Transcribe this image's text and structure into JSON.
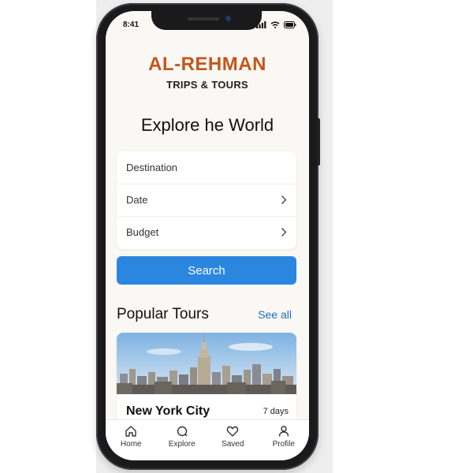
{
  "status_bar": {
    "time": "8:41",
    "signal_icon": "cellular-signal-icon",
    "wifi_icon": "wifi-icon",
    "battery_icon": "battery-icon"
  },
  "brand": {
    "name": "AL-REHMAN",
    "tagline": "TRIPS & TOURS",
    "color": "#c4561a"
  },
  "headline": "Explore he World",
  "search_form": {
    "fields": [
      {
        "label": "Destination",
        "has_chevron": false
      },
      {
        "label": "Date",
        "has_chevron": true
      },
      {
        "label": "Budget",
        "has_chevron": true
      }
    ],
    "search_button_label": "Search",
    "accent_color": "#2b86e0"
  },
  "popular_tours": {
    "title": "Popular Tours",
    "see_all_label": "See all",
    "tours": [
      {
        "name": "New York City",
        "duration": "7 days",
        "image_icon": "city-skyline-image"
      }
    ]
  },
  "tab_bar": {
    "tabs": [
      {
        "label": "Home",
        "icon": "home-icon"
      },
      {
        "label": "Explore",
        "icon": "explore-icon"
      },
      {
        "label": "Saved",
        "icon": "heart-icon"
      },
      {
        "label": "Profile",
        "icon": "profile-icon"
      }
    ]
  }
}
